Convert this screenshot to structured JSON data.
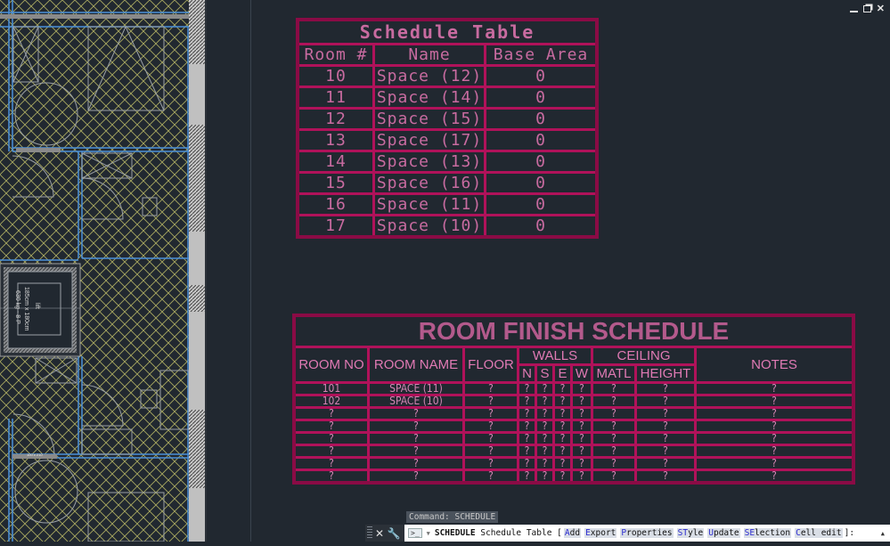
{
  "window_controls": {
    "minimize": "minimize",
    "restore": "restore",
    "close": "✕"
  },
  "drawing": {
    "labels": [
      "lift",
      "185cm x 180cm",
      "630 kg - 8 P",
      "100 x 210"
    ]
  },
  "schedule_table": {
    "title": "Schedule Table",
    "columns": [
      "Room #",
      "Name",
      "Base Area"
    ],
    "rows": [
      [
        "10",
        "Space (12)",
        "0"
      ],
      [
        "11",
        "Space (14)",
        "0"
      ],
      [
        "12",
        "Space (15)",
        "0"
      ],
      [
        "13",
        "Space (17)",
        "0"
      ],
      [
        "14",
        "Space (13)",
        "0"
      ],
      [
        "15",
        "Space (16)",
        "0"
      ],
      [
        "16",
        "Space (11)",
        "0"
      ],
      [
        "17",
        "Space (10)",
        "0"
      ]
    ]
  },
  "room_finish_schedule": {
    "title": "ROOM FINISH SCHEDULE",
    "headers": {
      "room_no": "ROOM NO",
      "room_name": "ROOM NAME",
      "floor": "FLOOR",
      "walls": "WALLS",
      "walls_sub": [
        "N",
        "S",
        "E",
        "W"
      ],
      "ceiling": "CEILING",
      "ceiling_sub": [
        "MATL",
        "HEIGHT"
      ],
      "notes": "NOTES"
    },
    "rows": [
      [
        "101",
        "SPACE (11)",
        "?",
        "?",
        "?",
        "?",
        "?",
        "?",
        "?",
        "?"
      ],
      [
        "102",
        "SPACE (10)",
        "?",
        "?",
        "?",
        "?",
        "?",
        "?",
        "?",
        "?"
      ],
      [
        "?",
        "?",
        "?",
        "?",
        "?",
        "?",
        "?",
        "?",
        "?",
        "?"
      ],
      [
        "?",
        "?",
        "?",
        "?",
        "?",
        "?",
        "?",
        "?",
        "?",
        "?"
      ],
      [
        "?",
        "?",
        "?",
        "?",
        "?",
        "?",
        "?",
        "?",
        "?",
        "?"
      ],
      [
        "?",
        "?",
        "?",
        "?",
        "?",
        "?",
        "?",
        "?",
        "?",
        "?"
      ],
      [
        "?",
        "?",
        "?",
        "?",
        "?",
        "?",
        "?",
        "?",
        "?",
        "?"
      ],
      [
        "?",
        "?",
        "?",
        "?",
        "?",
        "?",
        "?",
        "?",
        "?",
        "?"
      ]
    ]
  },
  "command": {
    "history": "Command: SCHEDULE",
    "prompt_icon": ">_",
    "command_name": "SCHEDULE",
    "prompt_text": "Schedule Table [",
    "options": [
      {
        "key": "A",
        "rest": "dd"
      },
      {
        "key": "E",
        "rest": "xport"
      },
      {
        "key": "P",
        "rest": "roperties"
      },
      {
        "key": "ST",
        "rest": "yle"
      },
      {
        "key": "U",
        "rest": "pdate"
      },
      {
        "key": "SE",
        "rest": "lection"
      },
      {
        "key": "C",
        "rest": "ell edit"
      }
    ],
    "suffix": "]:"
  }
}
